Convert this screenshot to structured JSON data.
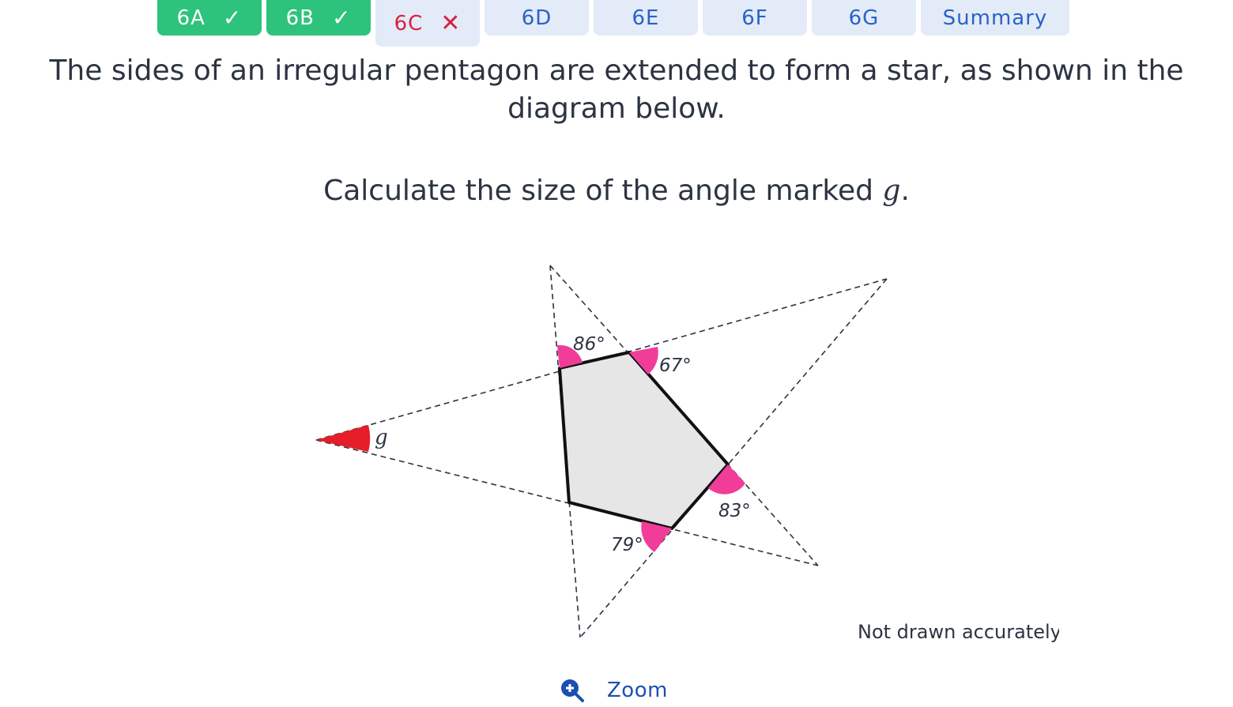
{
  "tabs": [
    {
      "label": "6A",
      "status": "correct",
      "mark": "✓"
    },
    {
      "label": "6B",
      "status": "correct",
      "mark": "✓"
    },
    {
      "label": "6C",
      "status": "incorrect",
      "mark": "✕"
    },
    {
      "label": "6D",
      "status": "unanswered",
      "mark": ""
    },
    {
      "label": "6E",
      "status": "unanswered",
      "mark": ""
    },
    {
      "label": "6F",
      "status": "unanswered",
      "mark": ""
    },
    {
      "label": "6G",
      "status": "unanswered",
      "mark": ""
    },
    {
      "label": "Summary",
      "status": "summary",
      "mark": ""
    }
  ],
  "question": {
    "line1": "The sides of an irregular pentagon are extended to form a star, as shown in the",
    "line2": "diagram below.",
    "prompt_prefix": "Calculate the size of the angle marked ",
    "prompt_var": "g",
    "prompt_suffix": "."
  },
  "diagram": {
    "angles": {
      "top_left": "86°",
      "top_right": "67°",
      "right": "83°",
      "bottom": "79°",
      "unknown": "g"
    },
    "note": "Not drawn accurately"
  },
  "zoom": {
    "label": "Zoom"
  },
  "colors": {
    "correct_tab": "#2ec37c",
    "pending_tab": "#e2ebf7",
    "incorrect_text": "#d9213f",
    "link_blue": "#2a62c7",
    "angle_pink": "#f13c9a",
    "angle_red": "#e61e2a",
    "pentagon_fill": "#e6e6e6"
  }
}
